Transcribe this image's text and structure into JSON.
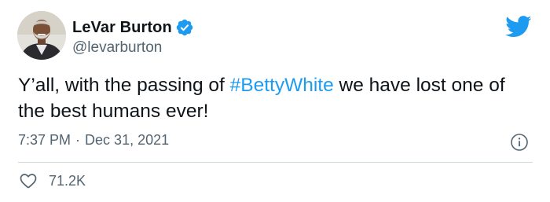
{
  "author": {
    "display_name": "LeVar Burton",
    "handle": "@levarburton",
    "verified": true
  },
  "tweet": {
    "text_before": "Y’all, with the passing of ",
    "hashtag": "#BettyWhite",
    "text_after": " we have lost one of the best humans ever!"
  },
  "meta": {
    "time": "7:37 PM",
    "separator": "·",
    "date": "Dec 31, 2021"
  },
  "engagement": {
    "likes": "71.2K"
  },
  "icons": {
    "brand": "twitter-bird-icon",
    "verified": "verified-badge-icon",
    "info": "info-icon",
    "like": "heart-icon"
  },
  "colors": {
    "accent": "#1d9bf0",
    "text_primary": "#0f1419",
    "text_secondary": "#536471",
    "divider": "#cfd9de"
  }
}
